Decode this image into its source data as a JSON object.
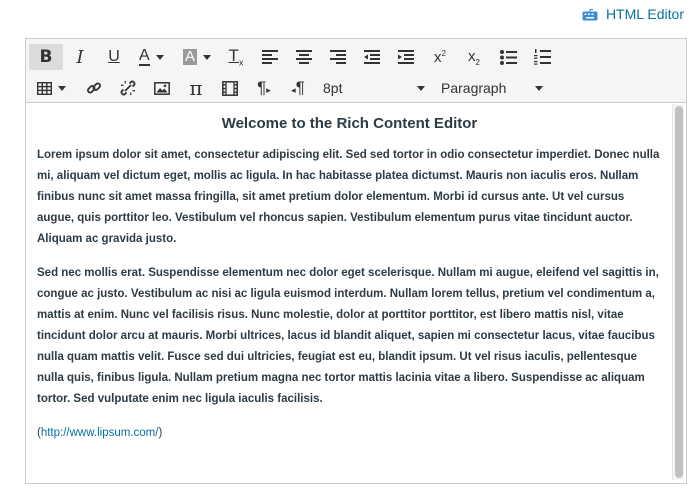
{
  "header": {
    "html_editor_label": "HTML Editor",
    "icon": "keyboard-icon",
    "link_color": "#0770a3"
  },
  "toolbar": {
    "row1": [
      {
        "name": "bold-button",
        "glyph": "B",
        "active": true
      },
      {
        "name": "italic-button",
        "glyph": "I"
      },
      {
        "name": "underline-button",
        "glyph": "U"
      },
      {
        "name": "text-color-button",
        "glyph": "A",
        "dropdown": true
      },
      {
        "name": "background-color-button",
        "glyph": "A",
        "dropdown": true
      },
      {
        "name": "clear-formatting-button",
        "glyph": "T"
      },
      {
        "name": "align-left-button",
        "icon": "align-left-icon"
      },
      {
        "name": "align-center-button",
        "icon": "align-center-icon"
      },
      {
        "name": "align-right-button",
        "icon": "align-right-icon"
      },
      {
        "name": "outdent-button",
        "icon": "outdent-icon"
      },
      {
        "name": "indent-button",
        "icon": "indent-icon"
      },
      {
        "name": "superscript-button",
        "icon": "superscript-icon"
      },
      {
        "name": "subscript-button",
        "icon": "subscript-icon"
      },
      {
        "name": "bullet-list-button",
        "icon": "bullet-list-icon"
      },
      {
        "name": "numbered-list-button",
        "icon": "numbered-list-icon"
      }
    ],
    "row2_icons": [
      "table-icon",
      "link-icon",
      "unlink-icon",
      "image-icon",
      "pi-icon",
      "media-icon",
      "ltr-icon",
      "rtl-icon"
    ],
    "font_size": "8pt",
    "block_format": "Paragraph"
  },
  "content": {
    "heading": "Welcome to the Rich Content Editor",
    "paragraph1": "Lorem ipsum dolor sit amet, consectetur adipiscing elit. Sed sed tortor in odio consectetur imperdiet. Donec nulla mi, aliquam vel dictum eget, mollis ac ligula. In hac habitasse platea dictumst. Mauris non iaculis eros. Nullam finibus nunc sit amet massa fringilla, sit amet pretium dolor elementum. Morbi id cursus ante. Ut vel cursus augue, quis porttitor leo. Vestibulum vel rhoncus sapien. Vestibulum elementum purus vitae tincidunt auctor. Aliquam ac gravida justo.",
    "paragraph2": "Sed nec mollis erat. Suspendisse elementum nec dolor eget scelerisque. Nullam mi augue, eleifend vel sagittis in, congue ac justo. Vestibulum ac nisi ac ligula euismod interdum. Nullam lorem tellus, pretium vel condimentum a, mattis at enim. Nunc vel facilisis risus. Nunc molestie, dolor at porttitor porttitor, est libero mattis nisl, vitae tincidunt dolor arcu at mauris. Morbi ultrices, lacus id blandit aliquet, sapien mi consectetur lacus, vitae faucibus nulla quam mattis velit. Fusce sed dui ultricies, feugiat est eu, blandit ipsum. Ut vel risus iaculis, pellentesque nulla quis, finibus ligula. Nullam pretium magna nec tortor mattis lacinia vitae a libero. Suspendisse ac aliquam tortor. Sed vulputate enim nec ligula iaculis facilisis.",
    "link_open": "(",
    "link_text": "http://www.lipsum.com/",
    "link_close": ")"
  }
}
